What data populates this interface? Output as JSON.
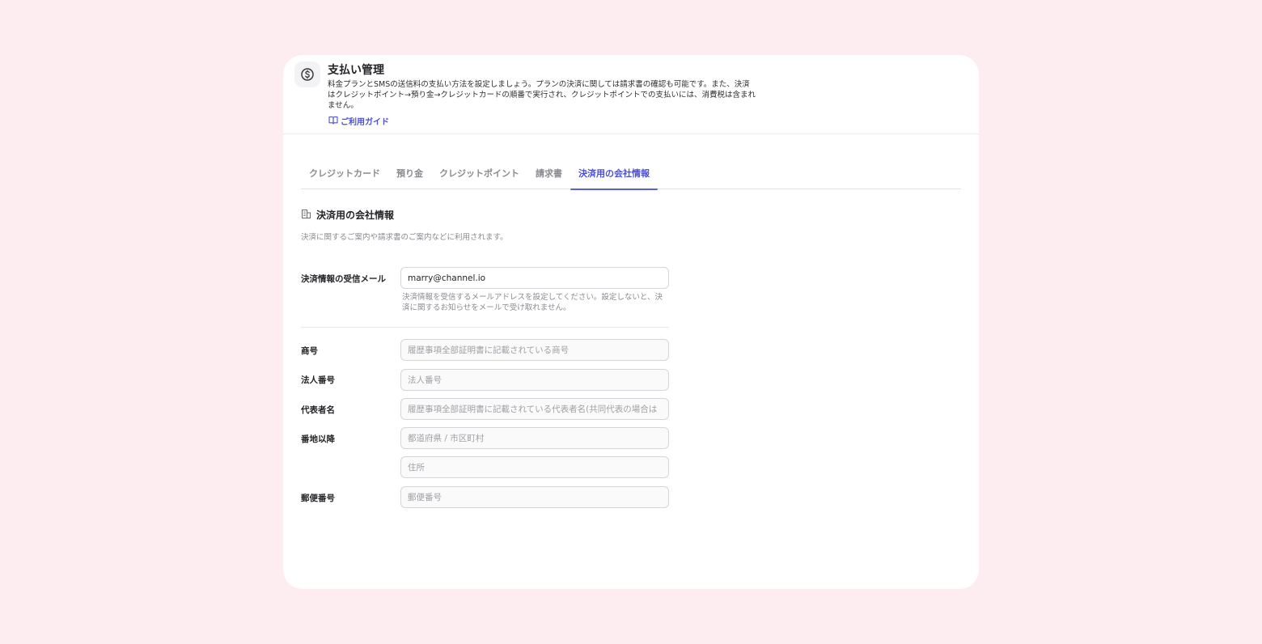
{
  "header": {
    "icon": "dollar-circle-icon",
    "title": "支払い管理",
    "description": "料金プランとSMSの送信料の支払い方法を設定しましょう。プランの決済に関しては請求書の確認も可能です。また、決済はクレジットポイント→預り金→クレジットカードの順番で実行され、クレジットポイントでの支払いには、消費税は含まれません。",
    "guide_link": "ご利用ガイド",
    "guide_icon": "book-icon"
  },
  "tabs": [
    {
      "label": "クレジットカード",
      "active": false
    },
    {
      "label": "預り金",
      "active": false
    },
    {
      "label": "クレジットポイント",
      "active": false
    },
    {
      "label": "請求書",
      "active": false
    },
    {
      "label": "決済用の会社情報",
      "active": true
    }
  ],
  "section": {
    "icon": "building-icon",
    "title": "決済用の会社情報",
    "description": "決済に関するご案内や請求書のご案内などに利用されます。"
  },
  "form": {
    "email": {
      "label": "決済情報の受信メール",
      "value": "marry@channel.io",
      "hint": "決済情報を受信するメールアドレスを設定してください。設定しないと、決済に関するお知らせをメールで受け取れません。"
    },
    "company_name": {
      "label": "商号",
      "placeholder": "履歴事項全部証明書に記載されている商号"
    },
    "corporate_number": {
      "label": "法人番号",
      "placeholder": "法人番号"
    },
    "representative": {
      "label": "代表者名",
      "placeholder": "履歴事項全部証明書に記載されている代表者名(共同代表の場合は"
    },
    "address": {
      "label": "番地以降",
      "placeholder_city": "都道府県 / 市区町村",
      "placeholder_street": "住所"
    },
    "postal_code": {
      "label": "郵便番号",
      "placeholder": "郵便番号"
    }
  },
  "colors": {
    "background": "#fdedf0",
    "accent": "#4b4fd1"
  }
}
